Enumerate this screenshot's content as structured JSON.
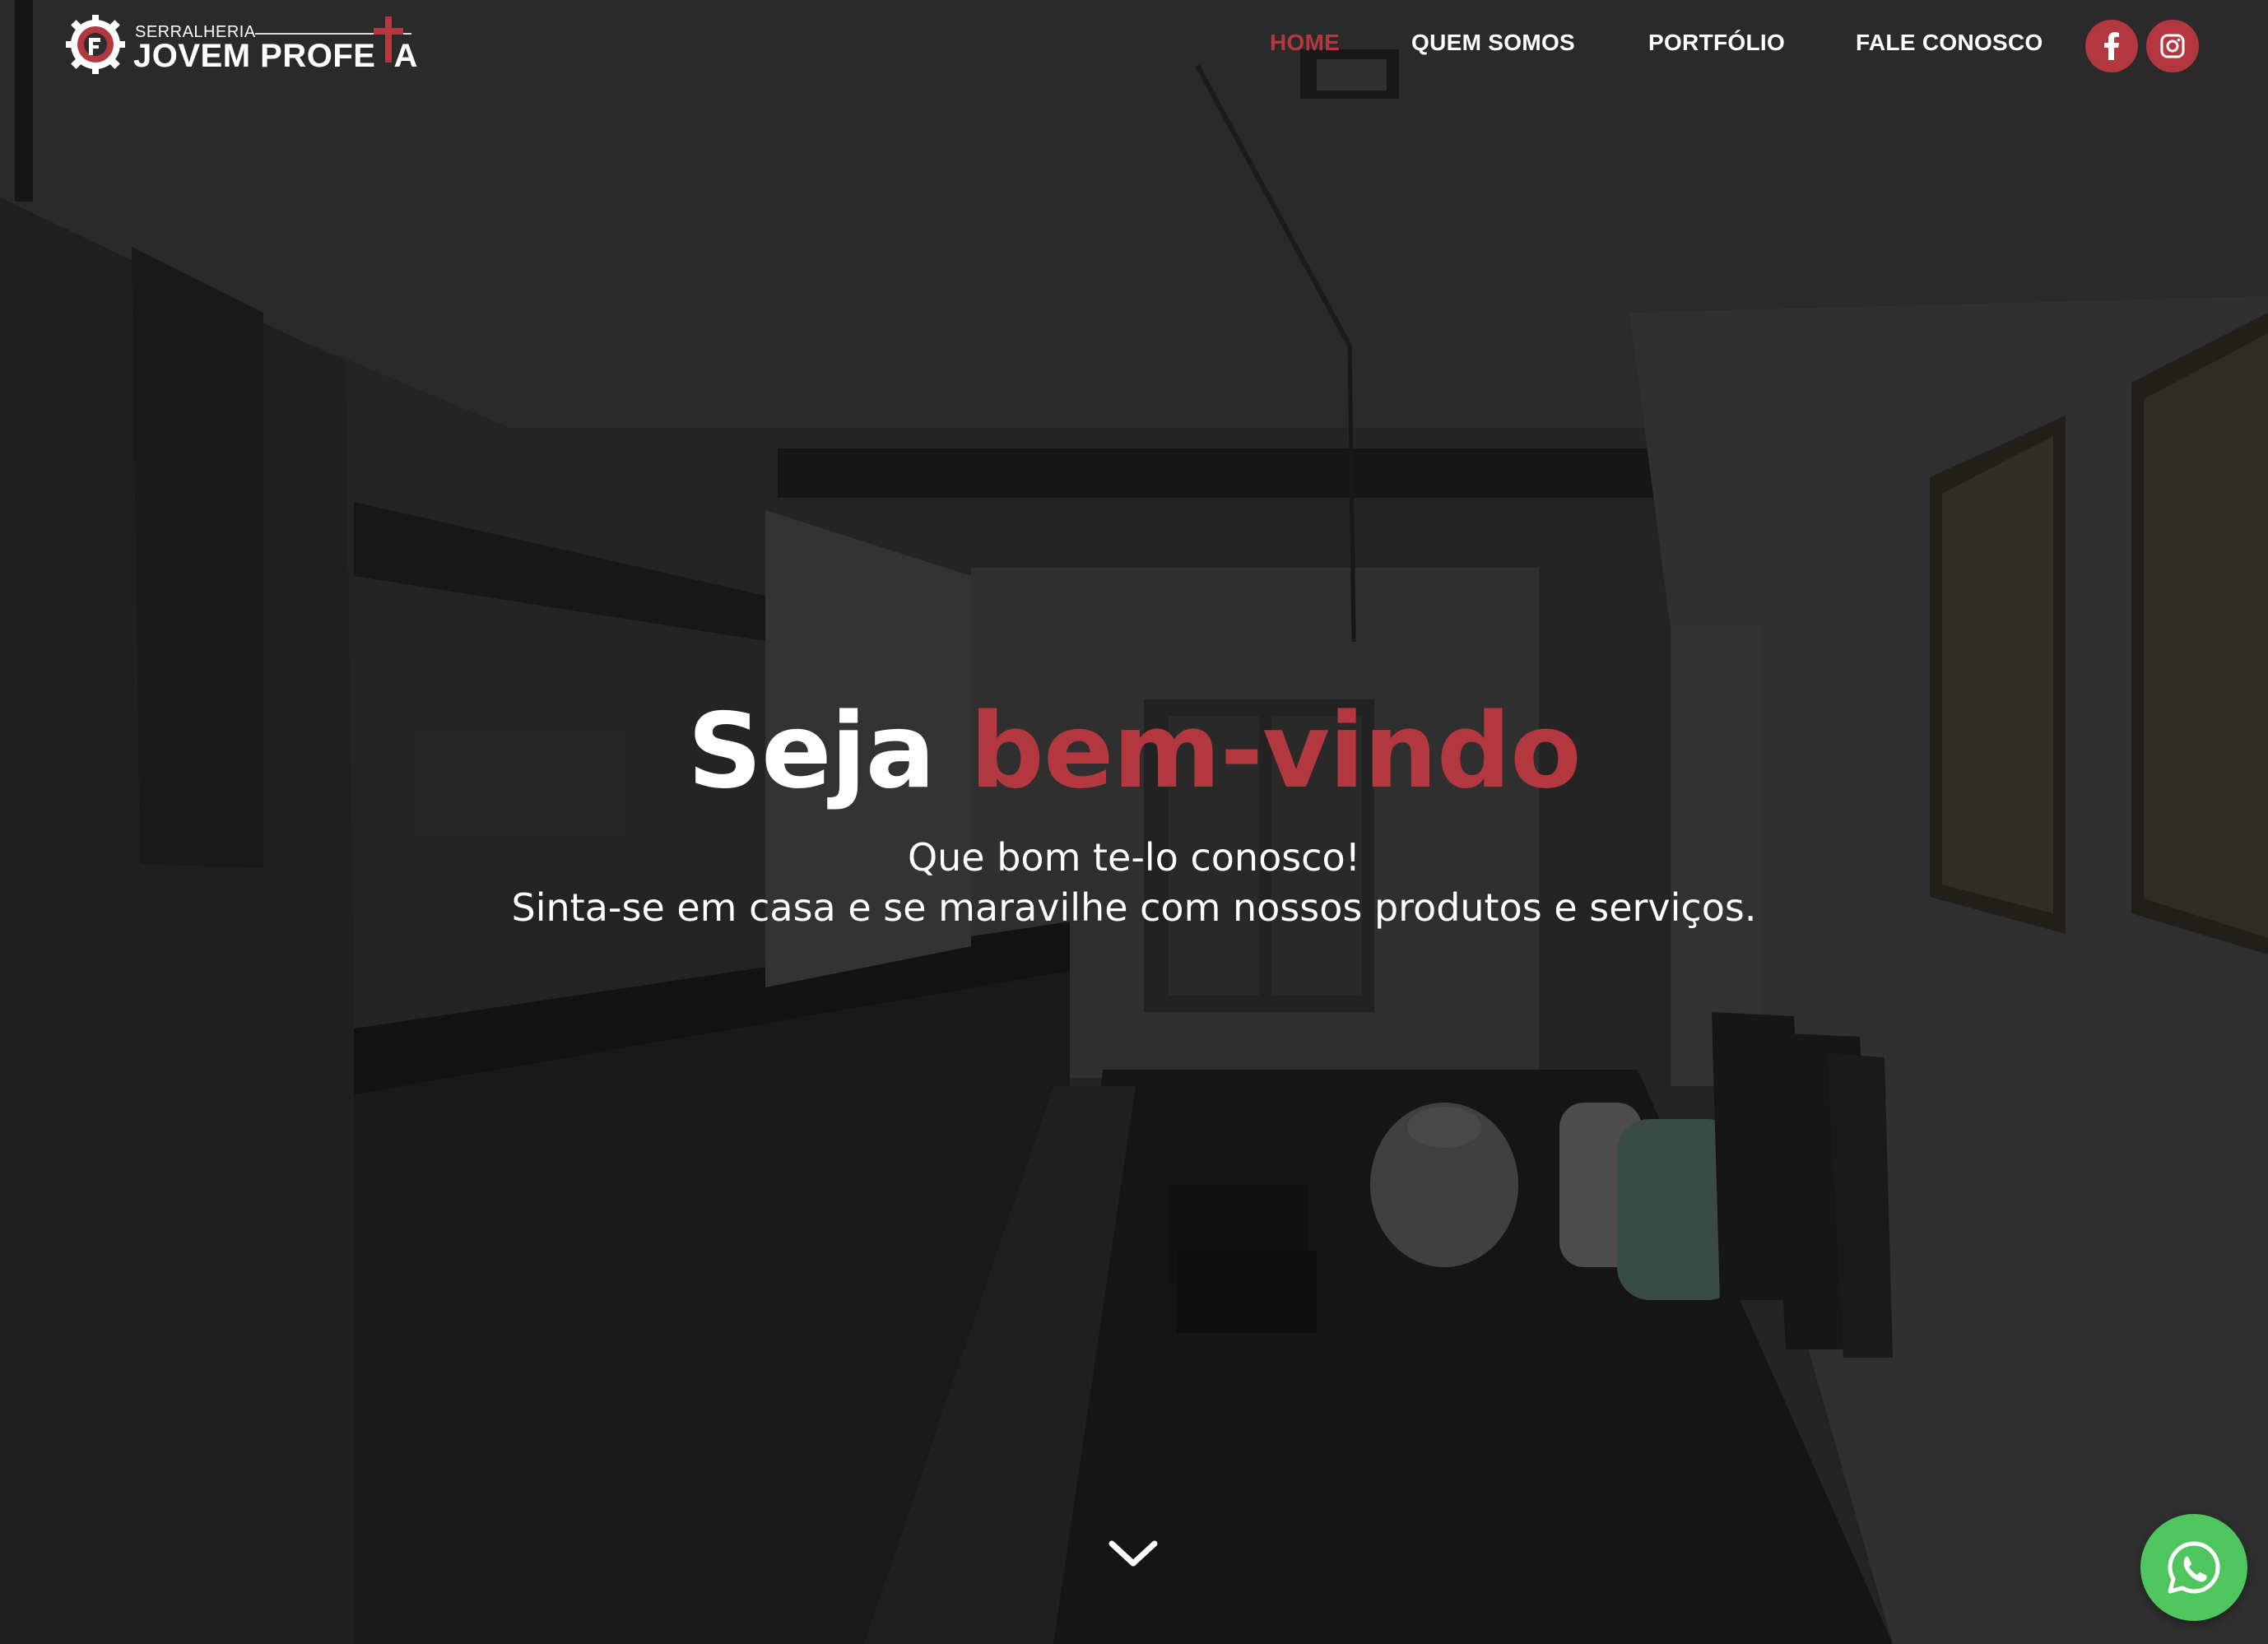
{
  "brand": {
    "tagline": "SERRALHERIA",
    "name": "JOVEM PROFE",
    "name_end": "A"
  },
  "nav": {
    "items": [
      {
        "label": "HOME",
        "active": true
      },
      {
        "label": "QUEM SOMOS",
        "active": false
      },
      {
        "label": "PORTFÓLIO",
        "active": false
      },
      {
        "label": "FALE CONOSCO",
        "active": false
      }
    ],
    "social": [
      {
        "icon": "facebook-icon"
      },
      {
        "icon": "instagram-icon"
      }
    ]
  },
  "hero": {
    "title_start": "Seja",
    "title_accent": "bem-vindo",
    "line1": "Que bom te-lo conosco!",
    "line2": "Sinta-se em casa e se maravilhe com nossos produtos e serviços."
  },
  "colors": {
    "accent": "#b4383f",
    "whatsapp": "#4fc65d",
    "text": "#ffffff"
  },
  "icons": {
    "scroll": "chevron-down-icon",
    "chat": "whatsapp-icon"
  }
}
